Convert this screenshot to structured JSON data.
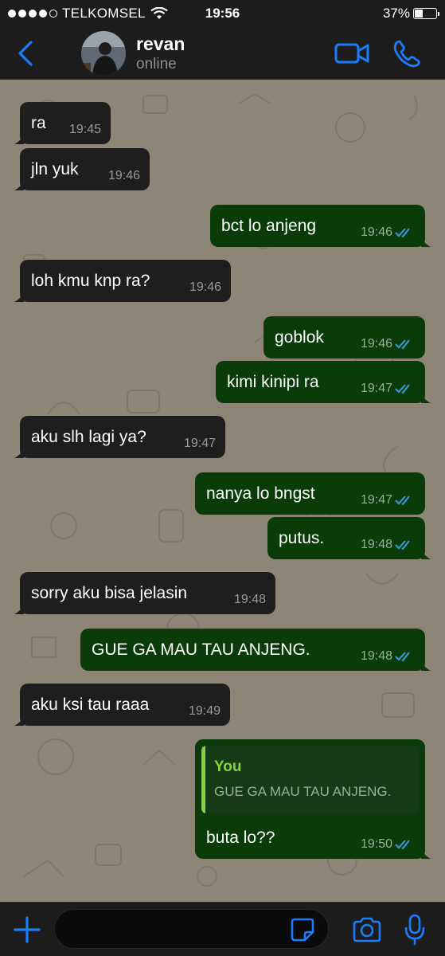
{
  "status_bar": {
    "carrier": "TELKOMSEL",
    "time": "19:56",
    "battery": "37%",
    "battery_level": 0.37,
    "signal_bars": 4
  },
  "header": {
    "contact_name": "revan",
    "contact_status": "online",
    "icons": [
      "back-chevron-icon",
      "video-call-icon",
      "phone-icon"
    ]
  },
  "colors": {
    "accent": "#1a7efb",
    "incoming_bubble": "#1e1e1e",
    "outgoing_bubble": "#0a3c0a",
    "chat_background": "#8d8677",
    "read_tick": "#3e9bd8",
    "quote_accent": "#8bd23c"
  },
  "messages": [
    {
      "direction": "in",
      "text": "ra",
      "time": "19:45"
    },
    {
      "direction": "in",
      "text": "jln yuk",
      "time": "19:46"
    },
    {
      "direction": "out",
      "text": "bct lo anjeng",
      "time": "19:46",
      "status": "read"
    },
    {
      "direction": "in",
      "text": "loh kmu knp ra?",
      "time": "19:46"
    },
    {
      "direction": "out",
      "text": "goblok",
      "time": "19:46",
      "status": "read"
    },
    {
      "direction": "out",
      "text": "kimi kinipi ra",
      "time": "19:47",
      "status": "read"
    },
    {
      "direction": "in",
      "text": "aku slh lagi ya?",
      "time": "19:47"
    },
    {
      "direction": "out",
      "text": "nanya lo bngst",
      "time": "19:47",
      "status": "read"
    },
    {
      "direction": "out",
      "text": "putus.",
      "time": "19:48",
      "status": "read"
    },
    {
      "direction": "in",
      "text": "sorry aku bisa jelasin",
      "time": "19:48"
    },
    {
      "direction": "out",
      "text": "GUE GA MAU TAU ANJENG.",
      "time": "19:48",
      "status": "read"
    },
    {
      "direction": "in",
      "text": "aku ksi tau raaa",
      "time": "19:49"
    },
    {
      "direction": "out",
      "text": "buta lo??",
      "time": "19:50",
      "status": "read",
      "quote": {
        "author": "You",
        "text": "GUE GA MAU TAU ANJENG."
      }
    }
  ],
  "input_bar": {
    "placeholder": "",
    "value": "",
    "icons": [
      "plus-icon",
      "sticker-icon",
      "camera-icon",
      "microphone-icon"
    ]
  }
}
